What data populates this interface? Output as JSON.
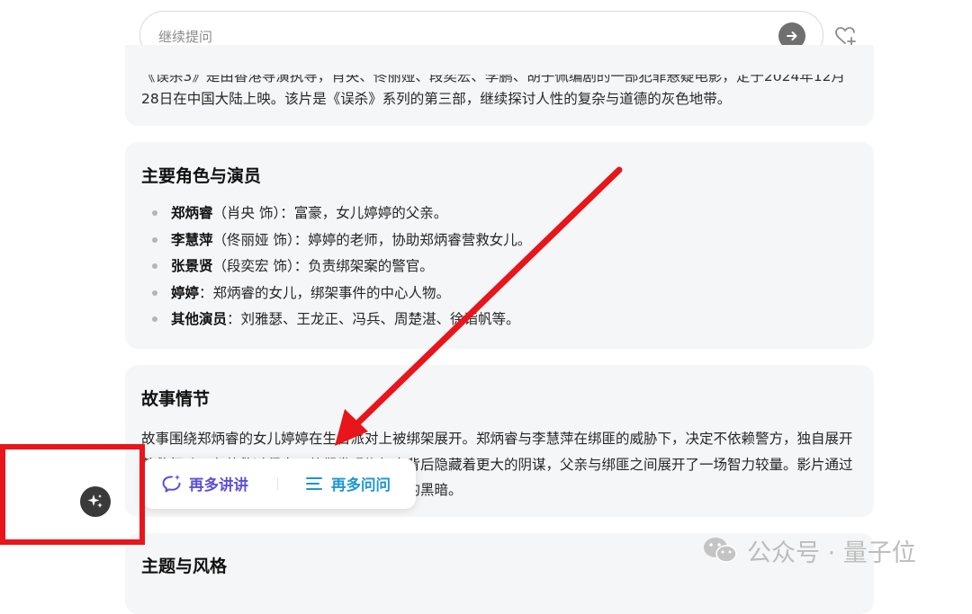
{
  "search": {
    "placeholder": "继续提问"
  },
  "intro": {
    "cut_line": "《误杀3》是由香港导演执导，肖央、佟丽娅、段奕宏、李鹏、胡子佩编剧的一部犯罪悬疑电影，定于2024年12月",
    "line2": "28日在中国大陆上映。该片是《误杀》系列的第三部，继续探讨人性的复杂与道德的灰色地带。"
  },
  "roles": {
    "title": "主要角色与演员",
    "items": [
      {
        "name": "郑炳睿",
        "desc": "（肖央 饰）：富豪，女儿婷婷的父亲。"
      },
      {
        "name": "李慧萍",
        "desc": "（佟丽娅 饰）：婷婷的老师，协助郑炳睿营救女儿。"
      },
      {
        "name": "张景贤",
        "desc": "（段奕宏 饰）：负责绑架案的警官。"
      },
      {
        "name": "婷婷",
        "desc": "：郑炳睿的女儿，绑架事件的中心人物。"
      },
      {
        "name": "其他演员",
        "desc": "：刘雅瑟、王龙正、冯兵、周楚湛、徐诣帆等。"
      }
    ]
  },
  "story": {
    "title": "故事情节",
    "text": "故事围绕郑炳睿的女儿婷婷在生日派对上被绑架展开。郑炳睿与李慧萍在绑匪的威胁下，决定不依赖警方，独自展开营救行动。在营救过程中，他们发现绑架案背后隐藏着更大的阴谋，父亲与绑匪之间展开了一场智力较量。影片通过复杂的人物关系，探讨了父爱的极限与人性的黑暗。"
  },
  "theme": {
    "title": "主题与风格"
  },
  "action_menu": {
    "more_talk": "再多讲讲",
    "more_ask": "再多问问"
  },
  "watermark": {
    "text": "公众号 · 量子位"
  },
  "colors": {
    "highlight_red": "#e8151b",
    "talk_purple": "#5a4fd6",
    "ask_blue": "#1c96d3",
    "card_bg": "#f5f6f7"
  }
}
